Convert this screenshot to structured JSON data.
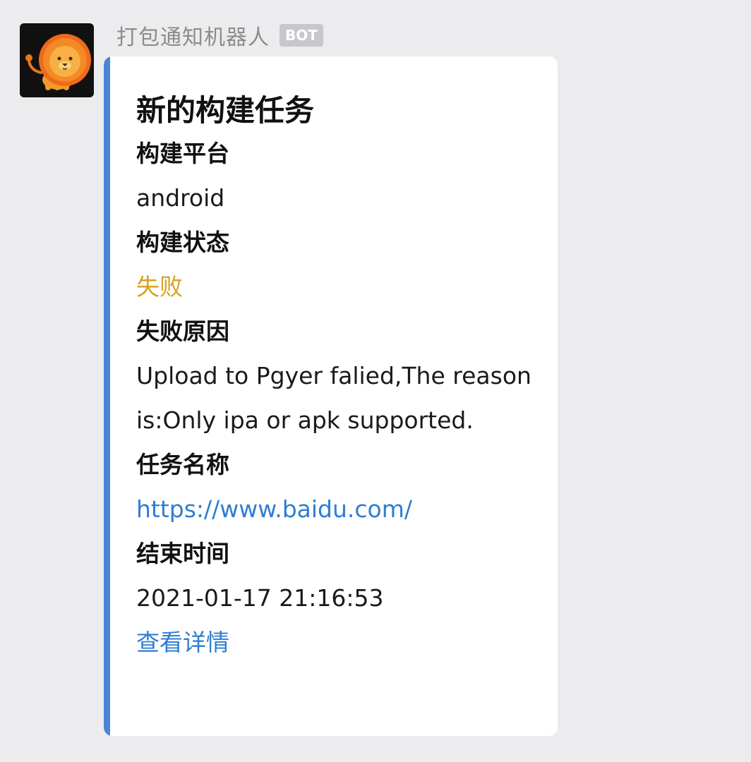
{
  "sender": {
    "name": "打包通知机器人",
    "badge": "BOT",
    "avatar_icon": "lion-icon"
  },
  "card": {
    "accent_color": "#4a86d4",
    "title": "新的构建任务",
    "fields": [
      {
        "label": "构建平台",
        "value": "android"
      },
      {
        "label": "构建状态",
        "value": "失败",
        "value_color": "#d7a321"
      },
      {
        "label": "失败原因",
        "value": "Upload to Pgyer falied,The reason is:Only ipa or apk supported."
      },
      {
        "label": "任务名称",
        "value": "https://www.baidu.com/",
        "value_color": "#2f7ed0"
      },
      {
        "label": "结束时间",
        "value": "2021-01-17 21:16:53"
      }
    ],
    "detail_link": "查看详情"
  }
}
